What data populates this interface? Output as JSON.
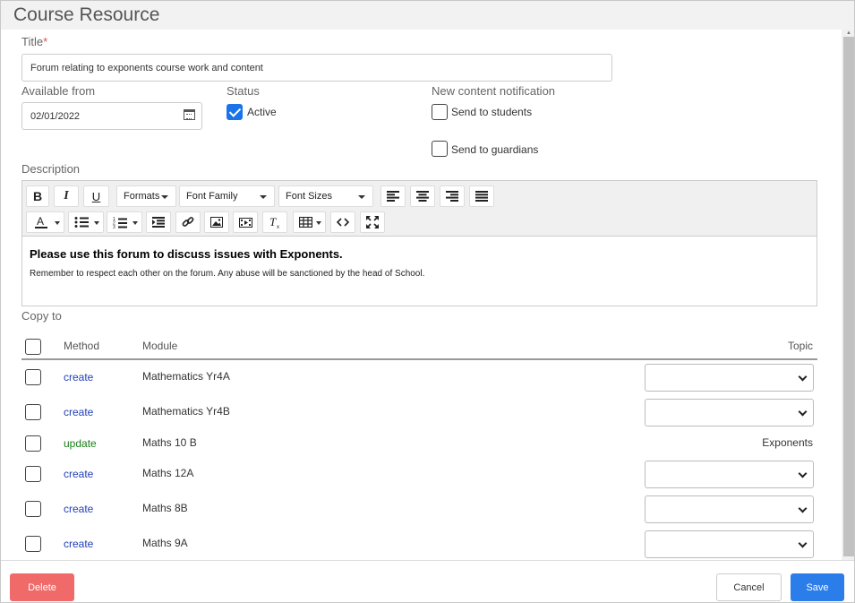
{
  "dialog": {
    "title": "Course Resource"
  },
  "form": {
    "title_label": "Title",
    "title_required": "*",
    "title_value": "Forum relating to exponents course work and content",
    "available_label": "Available from",
    "available_value": "02/01/2022",
    "status_label": "Status",
    "active_label": "Active",
    "active_checked": true,
    "notification_label": "New content notification",
    "send_students_label": "Send to students",
    "send_guardians_label": "Send to guardians",
    "description_label": "Description"
  },
  "editor": {
    "formats": "Formats",
    "font_family": "Font Family",
    "font_sizes": "Font Sizes",
    "bold": "B",
    "italic": "I",
    "underline": "U",
    "heading": "Please use this forum to discuss issues with Exponents.",
    "body": "Remember to respect each other on the forum. Any abuse will be sanctioned by the head of School."
  },
  "copy": {
    "label": "Copy to",
    "headers": {
      "method": "Method",
      "module": "Module",
      "topic": "Topic"
    },
    "rows": [
      {
        "method": "create",
        "module": "Mathematics Yr4A",
        "topic": ""
      },
      {
        "method": "create",
        "module": "Mathematics Yr4B",
        "topic": ""
      },
      {
        "method": "update",
        "module": "Maths 10 B",
        "topic": "Exponents"
      },
      {
        "method": "create",
        "module": "Maths 12A",
        "topic": ""
      },
      {
        "method": "create",
        "module": "Maths 8B",
        "topic": ""
      },
      {
        "method": "create",
        "module": "Maths 9A",
        "topic": ""
      }
    ]
  },
  "footer": {
    "delete": "Delete",
    "cancel": "Cancel",
    "save": "Save"
  },
  "colors": {
    "primary": "#2b7de9",
    "danger": "#f06a6a",
    "create": "#1f3fb8",
    "update": "#1a7f1a"
  }
}
